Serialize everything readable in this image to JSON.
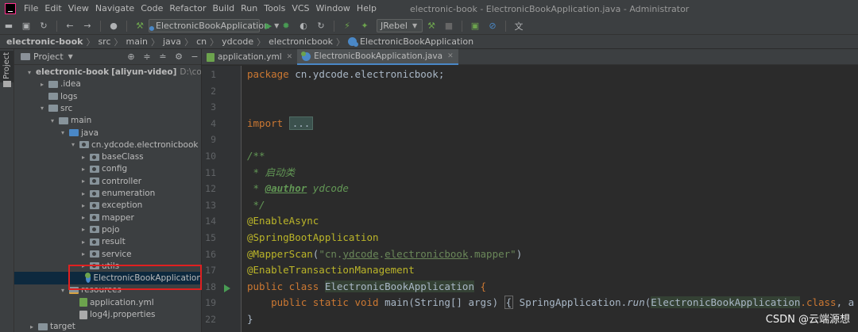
{
  "menubar": {
    "items": [
      "File",
      "Edit",
      "View",
      "Navigate",
      "Code",
      "Refactor",
      "Build",
      "Run",
      "Tools",
      "VCS",
      "Window",
      "Help"
    ],
    "window_title": "electronic-book - ElectronicBookApplication.java - Administrator"
  },
  "toolbar": {
    "run_config": "ElectronicBookApplication",
    "jrebel": "JRebel"
  },
  "breadcrumb": [
    "electronic-book",
    "src",
    "main",
    "java",
    "cn",
    "ydcode",
    "electronicbook",
    "ElectronicBookApplication"
  ],
  "left_stripe": {
    "label": "Project"
  },
  "project_panel": {
    "title": "Project",
    "tree": [
      {
        "label": "electronic-book",
        "extra": "[aliyun-video]",
        "path": "D:\\codes\\ele",
        "chev": "▾",
        "icon": "grey"
      },
      {
        "label": ".idea",
        "chev": "▸",
        "icon": "grey"
      },
      {
        "label": "logs",
        "chev": "",
        "icon": "grey"
      },
      {
        "label": "src",
        "chev": "▾",
        "icon": "grey"
      },
      {
        "label": "main",
        "chev": "▾",
        "icon": "grey"
      },
      {
        "label": "java",
        "chev": "▾",
        "icon": "blue"
      },
      {
        "label": "cn.ydcode.electronicbook",
        "chev": "▾",
        "icon": "pkg"
      },
      {
        "label": "baseClass",
        "chev": "▸",
        "icon": "pkg"
      },
      {
        "label": "config",
        "chev": "▸",
        "icon": "pkg"
      },
      {
        "label": "controller",
        "chev": "▸",
        "icon": "pkg"
      },
      {
        "label": "enumeration",
        "chev": "▸",
        "icon": "pkg"
      },
      {
        "label": "exception",
        "chev": "▸",
        "icon": "pkg"
      },
      {
        "label": "mapper",
        "chev": "▸",
        "icon": "pkg"
      },
      {
        "label": "pojo",
        "chev": "▸",
        "icon": "pkg"
      },
      {
        "label": "result",
        "chev": "▸",
        "icon": "pkg"
      },
      {
        "label": "service",
        "chev": "▸",
        "icon": "pkg"
      },
      {
        "label": "utils",
        "chev": "▸",
        "icon": "pkg"
      },
      {
        "label": "ElectronicBookApplication",
        "chev": "",
        "icon": "class",
        "selected": true
      },
      {
        "label": "resources",
        "chev": "▾",
        "icon": "res"
      },
      {
        "label": "application.yml",
        "chev": "",
        "icon": "yml"
      },
      {
        "label": "log4j.properties",
        "chev": "",
        "icon": "prop"
      },
      {
        "label": "target",
        "chev": "▸",
        "icon": "grey"
      }
    ]
  },
  "editor": {
    "tabs": [
      {
        "label": "application.yml",
        "icon": "yml",
        "active": false
      },
      {
        "label": "ElectronicBookApplication.java",
        "icon": "class",
        "active": true
      }
    ],
    "line_numbers": [
      "1",
      "2",
      "3",
      "4",
      "9",
      "10",
      "11",
      "12",
      "13",
      "14",
      "15",
      "16",
      "17",
      "18",
      "19",
      "22"
    ],
    "lines": [
      {
        "tokens": [
          [
            "kw",
            "package "
          ],
          [
            "",
            "cn.ydcode.electronicbook;"
          ]
        ]
      },
      {
        "tokens": []
      },
      {
        "tokens": []
      },
      {
        "tokens": [
          [
            "kw",
            "import "
          ],
          [
            "folded",
            "..."
          ]
        ]
      },
      {
        "tokens": []
      },
      {
        "tokens": [
          [
            "cmt",
            "/**"
          ]
        ]
      },
      {
        "tokens": [
          [
            "cmt",
            " * 启动类"
          ]
        ]
      },
      {
        "tokens": [
          [
            "cmt",
            " * "
          ],
          [
            "doc-tag",
            "@author"
          ],
          [
            "cmt",
            " ydcode"
          ]
        ]
      },
      {
        "tokens": [
          [
            "cmt",
            " */"
          ]
        ]
      },
      {
        "tokens": [
          [
            "ann",
            "@EnableAsync"
          ]
        ]
      },
      {
        "tokens": [
          [
            "ann",
            "@SpringBootApplication"
          ]
        ]
      },
      {
        "tokens": [
          [
            "ann",
            "@MapperScan"
          ],
          [
            "",
            "("
          ],
          [
            "str",
            "\"cn."
          ],
          [
            "str und",
            "ydcode"
          ],
          [
            "str",
            "."
          ],
          [
            "str und",
            "electronicbook"
          ],
          [
            "str",
            ".mapper\""
          ],
          [
            "",
            ")"
          ]
        ]
      },
      {
        "tokens": [
          [
            "ann",
            "@EnableTransactionManagement"
          ]
        ]
      },
      {
        "tokens": [
          [
            "kw",
            "public class "
          ],
          [
            "cls-hl",
            "ElectronicBookApplication"
          ],
          [
            "",
            " "
          ],
          [
            "kw",
            "{"
          ]
        ]
      },
      {
        "tokens": [
          [
            "",
            "    "
          ],
          [
            "kw",
            "public static void "
          ],
          [
            "",
            "main(String[] args) "
          ],
          [
            "brace-box",
            "{"
          ],
          [
            "",
            " SpringApplication."
          ],
          [
            "italic-fn",
            "run"
          ],
          [
            "",
            "("
          ],
          [
            "cls-hl",
            "ElectronicBookApplication"
          ],
          [
            "kw",
            ".class"
          ],
          [
            "",
            ", a"
          ]
        ]
      },
      {
        "tokens": [
          [
            "",
            "}"
          ]
        ]
      }
    ]
  },
  "watermark": "CSDN @云端源想"
}
